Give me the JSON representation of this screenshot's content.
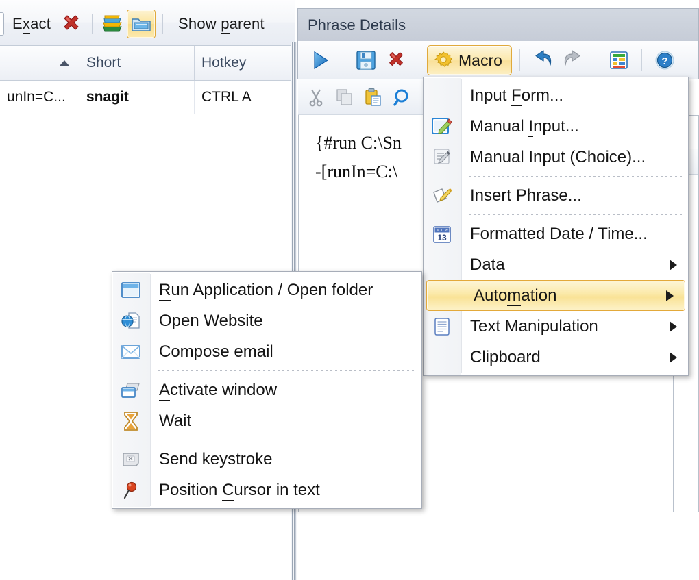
{
  "left_toolbar": {
    "exact_label": "Exact",
    "exact_accel": "x",
    "buttons": [
      {
        "name": "delete-icon",
        "label": "delete"
      },
      {
        "name": "folders-icon",
        "label": "folders"
      },
      {
        "name": "show-folder-icon",
        "label": "show folder",
        "selected": true
      }
    ],
    "show_parent_label": "Show parent",
    "show_parent_accel": "p"
  },
  "grid": {
    "columns": [
      "",
      "Short",
      "Hotkey"
    ],
    "sort_indicator": "ascending",
    "rows": [
      {
        "abbreviation": "unIn=C...",
        "short": "snagit",
        "hotkey": "CTRL A"
      }
    ]
  },
  "phrase_details": {
    "title": "Phrase Details",
    "toolbar": [
      {
        "name": "run-icon",
        "label": "Run"
      },
      {
        "name": "save-icon",
        "label": "Save"
      },
      {
        "name": "delete-icon",
        "label": "Delete"
      },
      {
        "name": "macro-button",
        "label": "Macro"
      },
      {
        "name": "undo-icon",
        "label": "Undo"
      },
      {
        "name": "redo-icon",
        "label": "Redo"
      },
      {
        "name": "table-icon",
        "label": "Table"
      },
      {
        "name": "help-icon",
        "label": "Help"
      }
    ],
    "macro_label": "Macro",
    "edit_toolbar": [
      {
        "name": "cut-icon",
        "label": "Cut"
      },
      {
        "name": "copy-icon",
        "label": "Copy"
      },
      {
        "name": "paste-icon",
        "label": "Paste"
      },
      {
        "name": "search-icon",
        "label": "Search"
      }
    ],
    "editor_lines": [
      "{#run C:\\Sn",
      "-[runIn=C:\\"
    ]
  },
  "macro_menu": {
    "items": [
      {
        "label": "Input Form...",
        "accel_index": 6,
        "icon": null,
        "submenu": false
      },
      {
        "label": "Manual Input...",
        "accel_index": 7,
        "icon": "manual-input-icon",
        "submenu": false
      },
      {
        "label": "Manual Input (Choice)...",
        "accel_index": -1,
        "icon": "manual-input-choice-icon",
        "submenu": false
      },
      {
        "separator": true
      },
      {
        "label": "Insert Phrase...",
        "accel_index": -1,
        "icon": "insert-phrase-icon",
        "submenu": false
      },
      {
        "separator": true
      },
      {
        "label": "Formatted Date / Time...",
        "accel_index": -1,
        "icon": "calendar-icon",
        "submenu": false
      },
      {
        "label": "Data",
        "accel_index": -1,
        "icon": null,
        "submenu": true
      },
      {
        "label": "Automation",
        "accel_index": 5,
        "icon": null,
        "submenu": true,
        "highlighted": true
      },
      {
        "label": "Text Manipulation",
        "accel_index": -1,
        "icon": "text-manipulation-icon",
        "submenu": true
      },
      {
        "label": "Clipboard",
        "accel_index": -1,
        "icon": null,
        "submenu": true
      }
    ]
  },
  "automation_menu": {
    "items": [
      {
        "label": "Run Application / Open folder",
        "accel_index": 0,
        "icon": "window-icon"
      },
      {
        "label": "Open Website",
        "accel_index": 5,
        "icon": "globe-page-icon"
      },
      {
        "label": "Compose email",
        "accel_index": 8,
        "icon": "envelope-icon"
      },
      {
        "separator": true
      },
      {
        "label": "Activate window",
        "accel_index": 0,
        "icon": "activate-window-icon"
      },
      {
        "label": "Wait",
        "accel_index": 1,
        "icon": "hourglass-icon"
      },
      {
        "separator": true
      },
      {
        "label": "Send keystroke",
        "accel_index": -1,
        "icon": "keyboard-key-icon"
      },
      {
        "label": "Position Cursor in text",
        "accel_index": 9,
        "icon": "pin-icon"
      }
    ]
  },
  "colors": {
    "highlight_border": "#e3a93a",
    "highlight_fill": "#fbe9a8",
    "panel_title_bg": "#c9cfda",
    "accent_blue": "#1c7fd6"
  }
}
